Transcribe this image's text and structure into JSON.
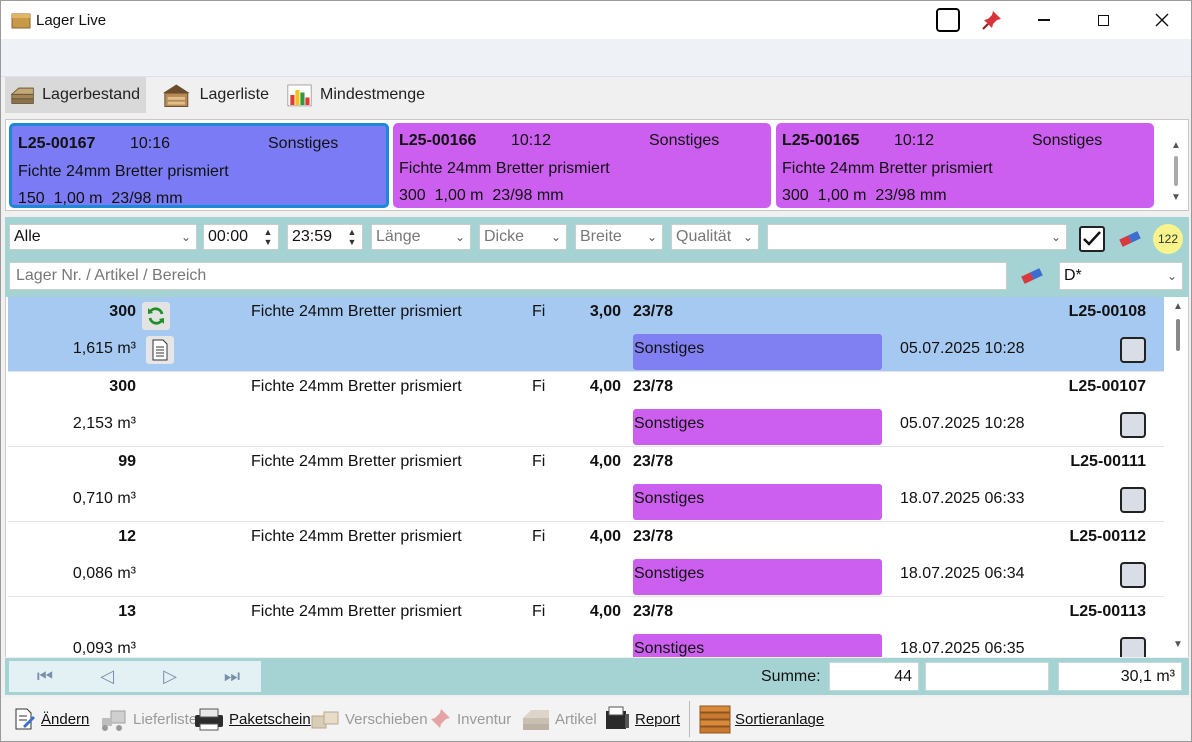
{
  "window": {
    "title": "Lager Live"
  },
  "tabs": [
    {
      "label": "Lagerbestand",
      "icon": "lumber-stack-icon",
      "active": true
    },
    {
      "label": "Lagerliste",
      "icon": "warehouse-icon",
      "active": false
    },
    {
      "label": "Mindestmenge",
      "icon": "bar-chart-icon",
      "active": false
    }
  ],
  "cards": [
    {
      "id": "L25-00167",
      "time": "10:16",
      "category": "Sonstiges",
      "article": "Fichte 24mm Bretter prismiert",
      "qty": "150",
      "length": "1,00 m",
      "dims": "23/98 mm",
      "color": "#7b7cf5",
      "selected": true
    },
    {
      "id": "L25-00166",
      "time": "10:12",
      "category": "Sonstiges",
      "article": "Fichte 24mm Bretter prismiert",
      "qty": "300",
      "length": "1,00 m",
      "dims": "23/98 mm",
      "color": "#cc5ff0",
      "selected": false
    },
    {
      "id": "L25-00165",
      "time": "10:12",
      "category": "Sonstiges",
      "article": "Fichte 24mm Bretter prismiert",
      "qty": "300",
      "length": "1,00 m",
      "dims": "23/98 mm",
      "color": "#cc5ff0",
      "selected": false
    }
  ],
  "filters": {
    "scope": "Alle",
    "time_from": "00:00",
    "time_to": "23:59",
    "length_placeholder": "Länge",
    "thickness_placeholder": "Dicke",
    "width_placeholder": "Breite",
    "quality_placeholder": "Qualität",
    "extra": "",
    "count_badge": "122",
    "search_placeholder": "Lager Nr.  / Artikel / Bereich",
    "sort": "D*"
  },
  "rows": [
    {
      "qty": "300",
      "volume": "1,615 m³",
      "article": "Fichte 24mm Bretter prismiert",
      "species": "Fi",
      "length": "3,00",
      "dims": "23/78",
      "category": "Sonstiges",
      "date": "05.07.2025 10:28",
      "id": "L25-00108",
      "tag_color": "#8080f2",
      "selected": true
    },
    {
      "qty": "300",
      "volume": "2,153 m³",
      "article": "Fichte 24mm Bretter prismiert",
      "species": "Fi",
      "length": "4,00",
      "dims": "23/78",
      "category": "Sonstiges",
      "date": "05.07.2025 10:28",
      "id": "L25-00107",
      "tag_color": "#cc5ff0",
      "selected": false
    },
    {
      "qty": "99",
      "volume": "0,710 m³",
      "article": "Fichte 24mm Bretter prismiert",
      "species": "Fi",
      "length": "4,00",
      "dims": "23/78",
      "category": "Sonstiges",
      "date": "18.07.2025 06:33",
      "id": "L25-00111",
      "tag_color": "#cc5ff0",
      "selected": false
    },
    {
      "qty": "12",
      "volume": "0,086 m³",
      "article": "Fichte 24mm Bretter prismiert",
      "species": "Fi",
      "length": "4,00",
      "dims": "23/78",
      "category": "Sonstiges",
      "date": "18.07.2025 06:34",
      "id": "L25-00112",
      "tag_color": "#cc5ff0",
      "selected": false
    },
    {
      "qty": "13",
      "volume": "0,093 m³",
      "article": "Fichte 24mm Bretter prismiert",
      "species": "Fi",
      "length": "4,00",
      "dims": "23/78",
      "category": "Sonstiges",
      "date": "18.07.2025 06:35",
      "id": "L25-00113",
      "tag_color": "#cc5ff0",
      "selected": false
    }
  ],
  "summary": {
    "label": "Summe:",
    "count": "44",
    "empty": "",
    "volume": "30,1 m³"
  },
  "footer_buttons": [
    {
      "label": "Ändern",
      "icon": "edit-icon",
      "enabled": true
    },
    {
      "label": "Lieferliste",
      "icon": "forklift-icon",
      "enabled": false
    },
    {
      "label": "Paketschein",
      "icon": "printer-icon",
      "enabled": true
    },
    {
      "label": "Verschieben",
      "icon": "move-boxes-icon",
      "enabled": false
    },
    {
      "label": "Inventur",
      "icon": "pin-icon",
      "enabled": false
    },
    {
      "label": "Artikel",
      "icon": "lumber-icon",
      "enabled": false
    },
    {
      "label": "Report",
      "icon": "report-printer-icon",
      "enabled": true
    },
    {
      "label": "Sortieranlage",
      "icon": "wood-planks-icon",
      "enabled": true
    }
  ]
}
